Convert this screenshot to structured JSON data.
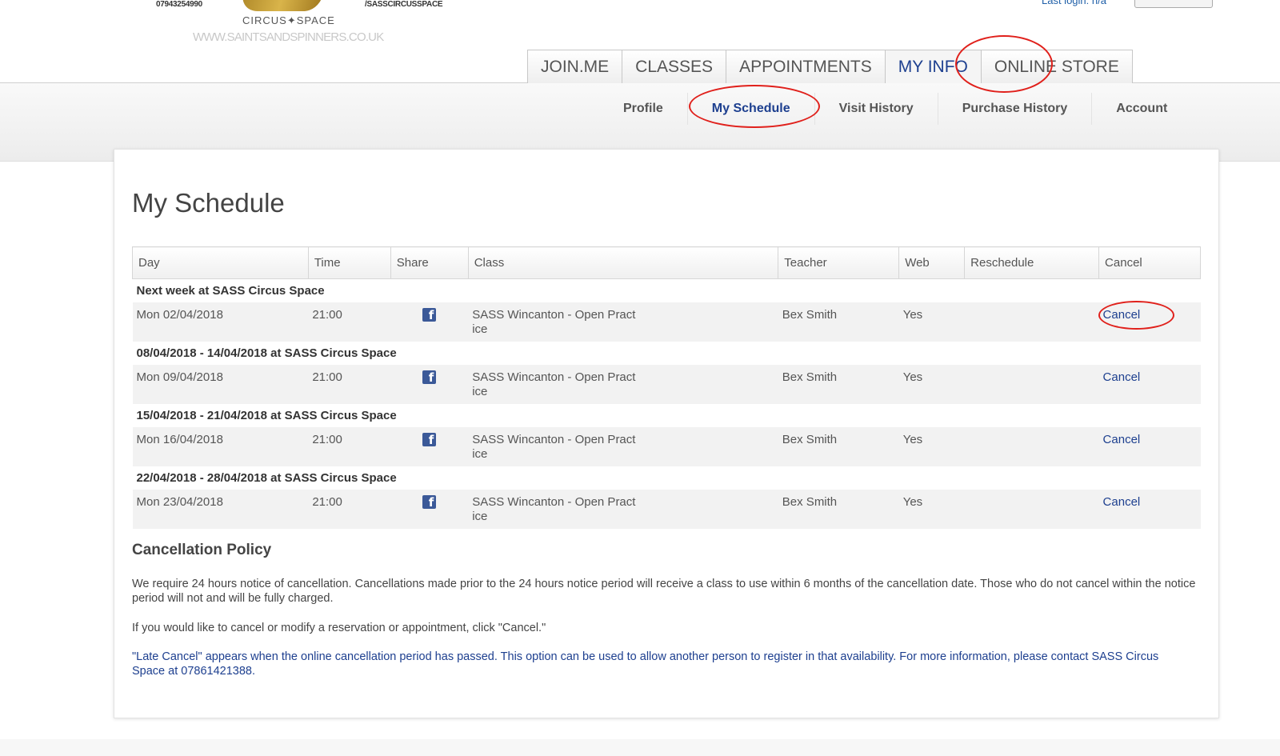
{
  "header": {
    "phone": "07943254990",
    "social": "/SASSCIRCUSSPACE",
    "logo_circus": "CIRCUS✦SPACE",
    "logo_url": "WWW.SAINTSANDSPINNERS.CO.UK",
    "last_login": "Last login: n/a"
  },
  "main_tabs": [
    {
      "label": "JOIN.ME"
    },
    {
      "label": "CLASSES"
    },
    {
      "label": "APPOINTMENTS"
    },
    {
      "label": "MY INFO"
    },
    {
      "label": "ONLINE STORE"
    }
  ],
  "sub_tabs": [
    {
      "label": "Profile"
    },
    {
      "label": "My Schedule"
    },
    {
      "label": "Visit History"
    },
    {
      "label": "Purchase History"
    },
    {
      "label": "Account"
    }
  ],
  "page_title": "My Schedule",
  "table": {
    "headers": [
      "Day",
      "Time",
      "Share",
      "Class",
      "Teacher",
      "Web",
      "Reschedule",
      "Cancel"
    ],
    "groups": [
      {
        "title": "Next week at SASS Circus Space",
        "row": {
          "day": "Mon 02/04/2018",
          "time": "21:00",
          "share_icon": "facebook-icon",
          "class_line1": "SASS Wincanton - Open Pract",
          "class_line2": "ice",
          "teacher": "Bex Smith",
          "web": "Yes",
          "reschedule": "",
          "cancel": "Cancel"
        }
      },
      {
        "title": "08/04/2018 - 14/04/2018 at SASS Circus Space",
        "row": {
          "day": "Mon 09/04/2018",
          "time": "21:00",
          "share_icon": "facebook-icon",
          "class_line1": "SASS Wincanton - Open Pract",
          "class_line2": "ice",
          "teacher": "Bex Smith",
          "web": "Yes",
          "reschedule": "",
          "cancel": "Cancel"
        }
      },
      {
        "title": "15/04/2018 - 21/04/2018 at SASS Circus Space",
        "row": {
          "day": "Mon 16/04/2018",
          "time": "21:00",
          "share_icon": "facebook-icon",
          "class_line1": "SASS Wincanton - Open Pract",
          "class_line2": "ice",
          "teacher": "Bex Smith",
          "web": "Yes",
          "reschedule": "",
          "cancel": "Cancel"
        }
      },
      {
        "title": "22/04/2018 - 28/04/2018 at SASS Circus Space",
        "row": {
          "day": "Mon 23/04/2018",
          "time": "21:00",
          "share_icon": "facebook-icon",
          "class_line1": "SASS Wincanton - Open Pract",
          "class_line2": "ice",
          "teacher": "Bex Smith",
          "web": "Yes",
          "reschedule": "",
          "cancel": "Cancel"
        }
      }
    ]
  },
  "policy": {
    "title": "Cancellation Policy",
    "p1": "We require 24 hours notice of cancellation. Cancellations made prior to the 24 hours notice period will receive a class to use within 6 months of the cancellation date. Those who do not cancel within the notice period will not and will be fully charged.",
    "p2": "If you would like to cancel or modify a reservation or appointment, click \"Cancel.\"",
    "p3": "\"Late Cancel\" appears when the online cancellation period has passed. This option can be used to allow another person to register in that availability. For more information, please contact SASS Circus Space at 07861421388."
  },
  "colors": {
    "accent": "#1d3f8f",
    "annotation": "#e0201b",
    "facebook": "#3b5998"
  }
}
